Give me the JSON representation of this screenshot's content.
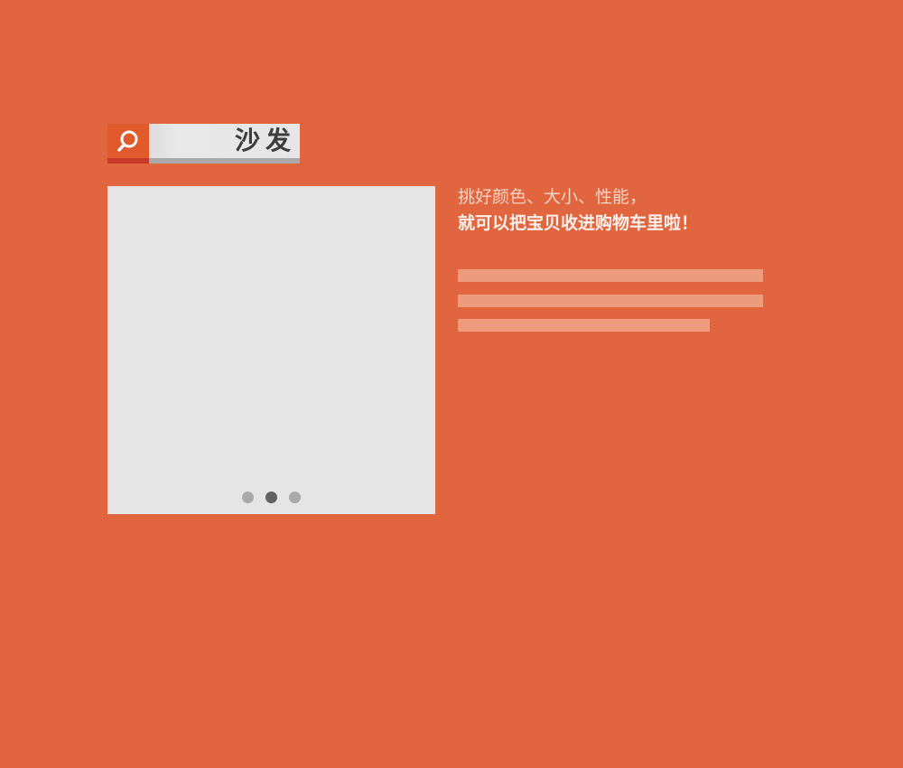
{
  "search": {
    "query": "沙发"
  },
  "product": {
    "carousel": {
      "count": 3,
      "active_index": 1
    }
  },
  "description": {
    "line1": "挑好颜色、大小、性能，",
    "line2": "就可以把宝贝收进购物车里啦！"
  },
  "colors": {
    "background": "#e1653f",
    "search_button": "#e15a2b",
    "panel": "#e5e5e5",
    "placeholder_line": "#ec9b7c"
  }
}
